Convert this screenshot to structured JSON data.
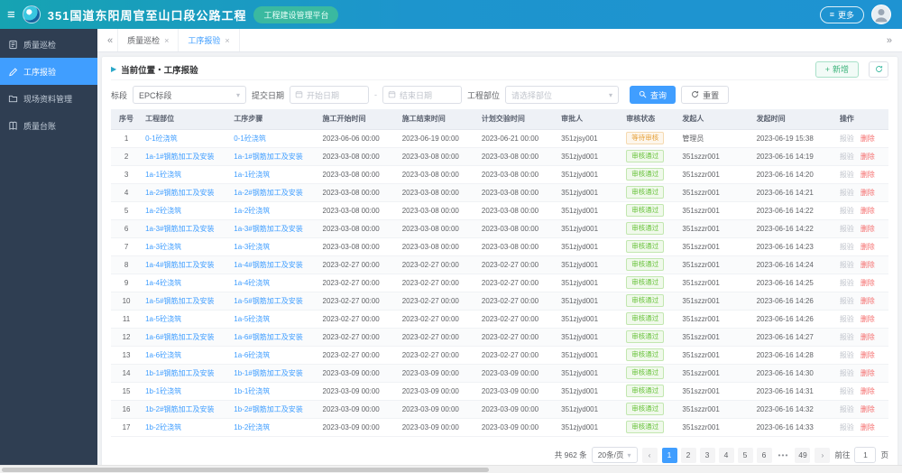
{
  "header": {
    "title": "351国道东阳周官至山口段公路工程",
    "badge": "工程建设管理平台",
    "more_label": "更多"
  },
  "colors": {
    "topbar_left": "#16a3b2",
    "topbar_right": "#1e93d2",
    "badge": "#3ab9a0",
    "sidebar": "#2f3e52",
    "accent": "#409eff",
    "status_pending": "#e6a23c",
    "status_pass": "#67c23a",
    "delete": "#f56c6c"
  },
  "sidebar": {
    "items": [
      {
        "label": "质量巡检",
        "icon": "clipboard-icon",
        "active": false
      },
      {
        "label": "工序报验",
        "icon": "pencil-icon",
        "active": true
      },
      {
        "label": "现场资料管理",
        "icon": "folder-icon",
        "active": false
      },
      {
        "label": "质量台账",
        "icon": "book-icon",
        "active": false
      }
    ]
  },
  "tabs": [
    {
      "label": "质量巡检",
      "active": false
    },
    {
      "label": "工序报验",
      "active": true
    }
  ],
  "breadcrumb": {
    "label": "当前位置・工序报验"
  },
  "toolbar": {
    "add_label": "新增"
  },
  "filters": {
    "section_label": "标段",
    "section_value": "EPC标段",
    "date_label": "提交日期",
    "date_start_placeholder": "开始日期",
    "date_separator": "-",
    "date_end_placeholder": "结束日期",
    "part_label": "工程部位",
    "part_placeholder": "请选择部位",
    "search_label": "查询",
    "reset_label": "重置"
  },
  "table": {
    "headers": [
      "序号",
      "工程部位",
      "工序步骤",
      "施工开始时间",
      "施工结束时间",
      "计划交验时间",
      "审批人",
      "审核状态",
      "发起人",
      "发起时间",
      "操作"
    ],
    "action_labels": {
      "report": "报验",
      "delete": "删除"
    },
    "rows": [
      {
        "no": "1",
        "part": "0-1砼浇筑",
        "step": "0-1砼浇筑",
        "start": "2023-06-06 00:00",
        "end": "2023-06-19 00:00",
        "plan": "2023-06-21 00:00",
        "approver": "351zjsy001",
        "status": "等待审核",
        "status_type": "pending",
        "initiator": "管理员",
        "time": "2023-06-19 15:38"
      },
      {
        "no": "2",
        "part": "1a-1#钢筋加工及安装",
        "step": "1a-1#钢筋加工及安装",
        "start": "2023-03-08 00:00",
        "end": "2023-03-08 00:00",
        "plan": "2023-03-08 00:00",
        "approver": "351zjyd001",
        "status": "审核通过",
        "status_type": "pass",
        "initiator": "351szzr001",
        "time": "2023-06-16 14:19"
      },
      {
        "no": "3",
        "part": "1a-1砼浇筑",
        "step": "1a-1砼浇筑",
        "start": "2023-03-08 00:00",
        "end": "2023-03-08 00:00",
        "plan": "2023-03-08 00:00",
        "approver": "351zjyd001",
        "status": "审核通过",
        "status_type": "pass",
        "initiator": "351szzr001",
        "time": "2023-06-16 14:20"
      },
      {
        "no": "4",
        "part": "1a-2#钢筋加工及安装",
        "step": "1a-2#钢筋加工及安装",
        "start": "2023-03-08 00:00",
        "end": "2023-03-08 00:00",
        "plan": "2023-03-08 00:00",
        "approver": "351zjyd001",
        "status": "审核通过",
        "status_type": "pass",
        "initiator": "351szzr001",
        "time": "2023-06-16 14:21"
      },
      {
        "no": "5",
        "part": "1a-2砼浇筑",
        "step": "1a-2砼浇筑",
        "start": "2023-03-08 00:00",
        "end": "2023-03-08 00:00",
        "plan": "2023-03-08 00:00",
        "approver": "351zjyd001",
        "status": "审核通过",
        "status_type": "pass",
        "initiator": "351szzr001",
        "time": "2023-06-16 14:22"
      },
      {
        "no": "6",
        "part": "1a-3#钢筋加工及安装",
        "step": "1a-3#钢筋加工及安装",
        "start": "2023-03-08 00:00",
        "end": "2023-03-08 00:00",
        "plan": "2023-03-08 00:00",
        "approver": "351zjyd001",
        "status": "审核通过",
        "status_type": "pass",
        "initiator": "351szzr001",
        "time": "2023-06-16 14:22"
      },
      {
        "no": "7",
        "part": "1a-3砼浇筑",
        "step": "1a-3砼浇筑",
        "start": "2023-03-08 00:00",
        "end": "2023-03-08 00:00",
        "plan": "2023-03-08 00:00",
        "approver": "351zjyd001",
        "status": "审核通过",
        "status_type": "pass",
        "initiator": "351szzr001",
        "time": "2023-06-16 14:23"
      },
      {
        "no": "8",
        "part": "1a-4#钢筋加工及安装",
        "step": "1a-4#钢筋加工及安装",
        "start": "2023-02-27 00:00",
        "end": "2023-02-27 00:00",
        "plan": "2023-02-27 00:00",
        "approver": "351zjyd001",
        "status": "审核通过",
        "status_type": "pass",
        "initiator": "351szzr001",
        "time": "2023-06-16 14:24"
      },
      {
        "no": "9",
        "part": "1a-4砼浇筑",
        "step": "1a-4砼浇筑",
        "start": "2023-02-27 00:00",
        "end": "2023-02-27 00:00",
        "plan": "2023-02-27 00:00",
        "approver": "351zjyd001",
        "status": "审核通过",
        "status_type": "pass",
        "initiator": "351szzr001",
        "time": "2023-06-16 14:25"
      },
      {
        "no": "10",
        "part": "1a-5#钢筋加工及安装",
        "step": "1a-5#钢筋加工及安装",
        "start": "2023-02-27 00:00",
        "end": "2023-02-27 00:00",
        "plan": "2023-02-27 00:00",
        "approver": "351zjyd001",
        "status": "审核通过",
        "status_type": "pass",
        "initiator": "351szzr001",
        "time": "2023-06-16 14:26"
      },
      {
        "no": "11",
        "part": "1a-5砼浇筑",
        "step": "1a-5砼浇筑",
        "start": "2023-02-27 00:00",
        "end": "2023-02-27 00:00",
        "plan": "2023-02-27 00:00",
        "approver": "351zjyd001",
        "status": "审核通过",
        "status_type": "pass",
        "initiator": "351szzr001",
        "time": "2023-06-16 14:26"
      },
      {
        "no": "12",
        "part": "1a-6#钢筋加工及安装",
        "step": "1a-6#钢筋加工及安装",
        "start": "2023-02-27 00:00",
        "end": "2023-02-27 00:00",
        "plan": "2023-02-27 00:00",
        "approver": "351zjyd001",
        "status": "审核通过",
        "status_type": "pass",
        "initiator": "351szzr001",
        "time": "2023-06-16 14:27"
      },
      {
        "no": "13",
        "part": "1a-6砼浇筑",
        "step": "1a-6砼浇筑",
        "start": "2023-02-27 00:00",
        "end": "2023-02-27 00:00",
        "plan": "2023-02-27 00:00",
        "approver": "351zjyd001",
        "status": "审核通过",
        "status_type": "pass",
        "initiator": "351szzr001",
        "time": "2023-06-16 14:28"
      },
      {
        "no": "14",
        "part": "1b-1#钢筋加工及安装",
        "step": "1b-1#钢筋加工及安装",
        "start": "2023-03-09 00:00",
        "end": "2023-03-09 00:00",
        "plan": "2023-03-09 00:00",
        "approver": "351zjyd001",
        "status": "审核通过",
        "status_type": "pass",
        "initiator": "351szzr001",
        "time": "2023-06-16 14:30"
      },
      {
        "no": "15",
        "part": "1b-1砼浇筑",
        "step": "1b-1砼浇筑",
        "start": "2023-03-09 00:00",
        "end": "2023-03-09 00:00",
        "plan": "2023-03-09 00:00",
        "approver": "351zjyd001",
        "status": "审核通过",
        "status_type": "pass",
        "initiator": "351szzr001",
        "time": "2023-06-16 14:31"
      },
      {
        "no": "16",
        "part": "1b-2#钢筋加工及安装",
        "step": "1b-2#钢筋加工及安装",
        "start": "2023-03-09 00:00",
        "end": "2023-03-09 00:00",
        "plan": "2023-03-09 00:00",
        "approver": "351zjyd001",
        "status": "审核通过",
        "status_type": "pass",
        "initiator": "351szzr001",
        "time": "2023-06-16 14:32"
      },
      {
        "no": "17",
        "part": "1b-2砼浇筑",
        "step": "1b-2砼浇筑",
        "start": "2023-03-09 00:00",
        "end": "2023-03-09 00:00",
        "plan": "2023-03-09 00:00",
        "approver": "351zjyd001",
        "status": "审核通过",
        "status_type": "pass",
        "initiator": "351szzr001",
        "time": "2023-06-16 14:33"
      }
    ]
  },
  "pagination": {
    "total": "共 962 条",
    "page_size": "20条/页",
    "pages": [
      "1",
      "2",
      "3",
      "4",
      "5",
      "6",
      "...",
      "49"
    ],
    "active_page": "1",
    "goto_label": "前往",
    "goto_value": "1",
    "page_suffix": "页"
  }
}
